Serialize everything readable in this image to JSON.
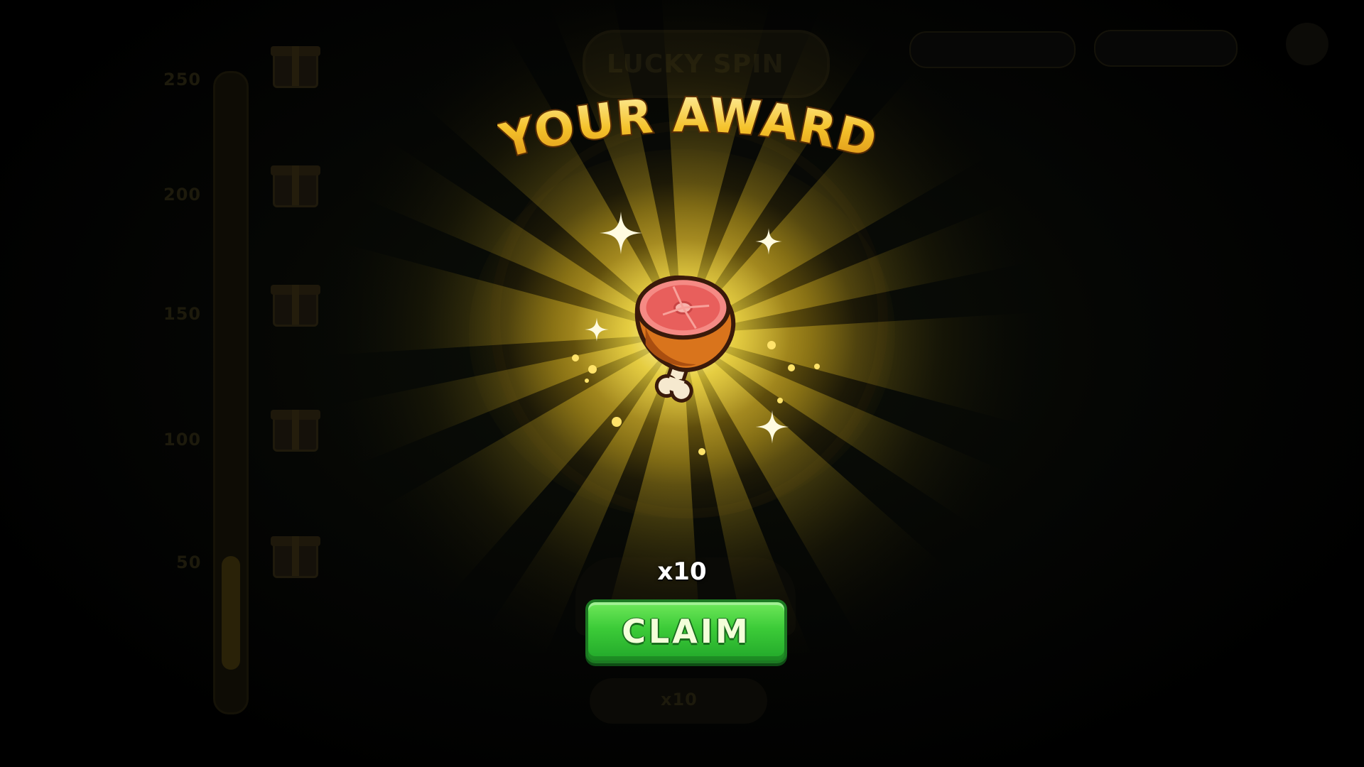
{
  "popup": {
    "title": "YOUR AWARD",
    "reward": {
      "icon": "meat-leg-icon",
      "quantity_label": "x10"
    },
    "claim_label": "CLAIM"
  },
  "background": {
    "wheel_title": "LUCKY SPIN",
    "progress_ticks": [
      "250",
      "200",
      "150",
      "100",
      "50"
    ],
    "spin_cost_label": "x10"
  },
  "colors": {
    "title_gold": "#f4c22b",
    "claim_green": "#3ccb38",
    "glow_yellow": "#f8dc3c"
  }
}
